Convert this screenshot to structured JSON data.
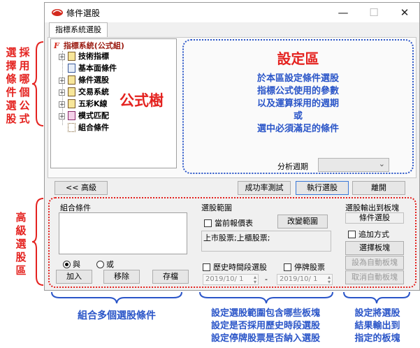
{
  "window": {
    "title": "條件選股",
    "tab": "指標系統選股"
  },
  "tree": {
    "root": "指標系統(公式組)",
    "items": [
      "技術指標",
      "基本面條件",
      "條件選股",
      "交易系統",
      "五彩K線",
      "模式匹配",
      "組合條件"
    ],
    "label": "公式樹"
  },
  "setting_area": {
    "title": "設定區",
    "lines": [
      "於本區設定條件選股",
      "指標公式使用的參數",
      "以及運算採用的週期",
      "或",
      "選中必須滿足的條件"
    ],
    "period_label": "分析週期",
    "period_value": ""
  },
  "buttons": {
    "advanced": "<< 高級",
    "success_test": "成功率測試",
    "execute": "執行選股",
    "leave": "離開"
  },
  "combo": {
    "title": "組合條件",
    "and": "與",
    "or": "或",
    "add": "加入",
    "remove": "移除",
    "save": "存檔"
  },
  "range": {
    "title": "選股範圍",
    "current_report": "當前報價表",
    "change_range": "改變範圍",
    "range_text": "上市股票;上櫃股票;",
    "history": "歷史時間段選股",
    "suspended": "停牌股票",
    "date_from": "2019/10/ 1",
    "date_sep": "-",
    "date_to": "2019/10/ 1"
  },
  "output": {
    "title": "選股輸出到板塊",
    "output_value": "條件選股",
    "append": "追加方式",
    "choose_block": "選擇板塊",
    "set_auto": "設為自動板塊",
    "cancel_auto": "取消自動板塊"
  },
  "annotations": {
    "left_top": [
      "選",
      "採",
      "擇",
      "用",
      "條",
      "哪",
      "件",
      "個",
      "選",
      "公",
      "股",
      "式"
    ],
    "left_bottom": [
      "高",
      "級",
      "選",
      "股",
      "區"
    ],
    "bottom_1": "組合多個選股條件",
    "bottom_2": [
      "設定選股範圍包含哪些板塊",
      "設定是否採用歷史時段選股",
      "設定停牌股票是否納入選股"
    ],
    "bottom_3": [
      "設定將選股",
      "結果輸出到",
      "指定的板塊"
    ]
  },
  "colors": {
    "annotation_red": "#e4221f",
    "annotation_blue": "#2a55c8"
  }
}
